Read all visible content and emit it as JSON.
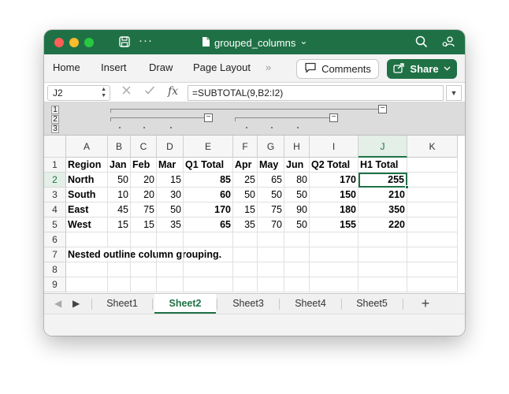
{
  "window": {
    "title": "grouped_columns",
    "title_chevron": "⌄"
  },
  "ribbon": {
    "tabs": [
      "Home",
      "Insert",
      "Draw",
      "Page Layout"
    ],
    "overflow": "»",
    "comments_label": "Comments",
    "share_label": "Share"
  },
  "formula_bar": {
    "name_box": "J2",
    "fx": "fx",
    "formula": "=SUBTOTAL(9,B2:I2)"
  },
  "outline": {
    "levels": [
      "1",
      "2",
      "3"
    ]
  },
  "sheet": {
    "columns": [
      "A",
      "B",
      "C",
      "D",
      "E",
      "F",
      "G",
      "H",
      "I",
      "J",
      "K"
    ],
    "selected_column": "J",
    "selected_row": "2",
    "rows": [
      [
        "Region",
        "Jan",
        "Feb",
        "Mar",
        "Q1 Total",
        "Apr",
        "May",
        "Jun",
        "Q2 Total",
        "H1 Total",
        ""
      ],
      [
        "North",
        "50",
        "20",
        "15",
        "85",
        "25",
        "65",
        "80",
        "170",
        "255",
        ""
      ],
      [
        "South",
        "10",
        "20",
        "30",
        "60",
        "50",
        "50",
        "50",
        "150",
        "210",
        ""
      ],
      [
        "East",
        "45",
        "75",
        "50",
        "170",
        "15",
        "75",
        "90",
        "180",
        "350",
        ""
      ],
      [
        "West",
        "15",
        "15",
        "35",
        "65",
        "35",
        "70",
        "50",
        "155",
        "220",
        ""
      ],
      [
        "",
        "",
        "",
        "",
        "",
        "",
        "",
        "",
        "",
        "",
        ""
      ],
      [
        "Nested outline column grouping.",
        "",
        "",
        "",
        "",
        "",
        "",
        "",
        "",
        "",
        ""
      ],
      [
        "",
        "",
        "",
        "",
        "",
        "",
        "",
        "",
        "",
        "",
        ""
      ],
      [
        "",
        "",
        "",
        "",
        "",
        "",
        "",
        "",
        "",
        "",
        ""
      ]
    ]
  },
  "sheet_tabs": [
    "Sheet1",
    "Sheet2",
    "Sheet3",
    "Sheet4",
    "Sheet5"
  ],
  "active_sheet": "Sheet2",
  "colors": {
    "accent": "#1f7145"
  }
}
